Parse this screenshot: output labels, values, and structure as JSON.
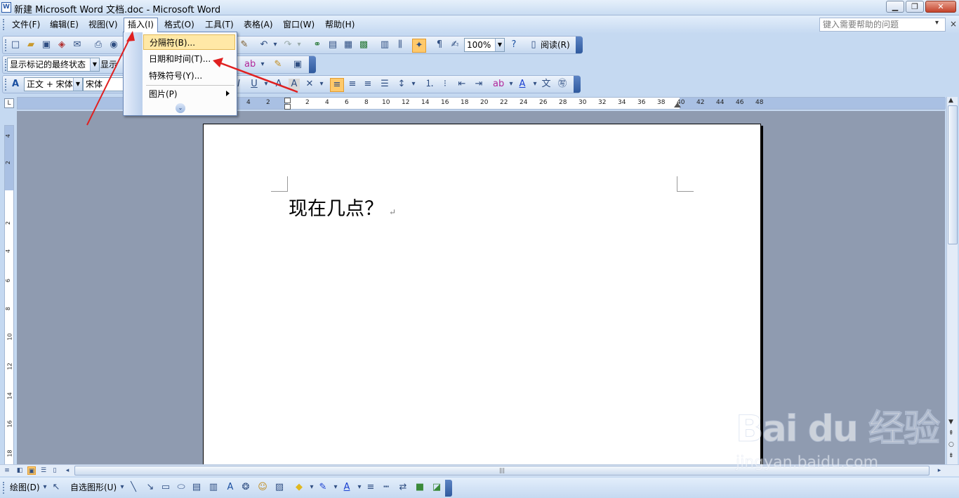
{
  "window": {
    "title": "新建 Microsoft Word 文档.doc - Microsoft Word",
    "min": "▁",
    "max": "❐",
    "close": "✕"
  },
  "menubar": {
    "items": [
      "文件(F)",
      "编辑(E)",
      "视图(V)",
      "插入(I)",
      "格式(O)",
      "工具(T)",
      "表格(A)",
      "窗口(W)",
      "帮助(H)"
    ]
  },
  "help": {
    "placeholder": "键入需要帮助的问题",
    "drop": "▾",
    "close": "×"
  },
  "standard_toolbar": {
    "zoom": "100%",
    "read_label": "阅读(R)"
  },
  "reviewing_toolbar": {
    "markup_state": "显示标记的最终状态",
    "show_label": "显示"
  },
  "formatting_toolbar": {
    "style": "正文 + 宋体",
    "font": "宋体"
  },
  "insert_menu": {
    "items": [
      "分隔符(B)...",
      "日期和时间(T)...",
      "特殊符号(Y)...",
      "图片(P)"
    ]
  },
  "ruler": {
    "h_labels": [
      "4",
      "2",
      "2",
      "4",
      "6",
      "8",
      "10",
      "12",
      "14",
      "16",
      "18",
      "20",
      "22",
      "24",
      "26",
      "28",
      "30",
      "32",
      "34",
      "36",
      "38",
      "40",
      "42",
      "44",
      "46",
      "48"
    ],
    "v_labels": [
      "4",
      "2",
      "2",
      "4",
      "6",
      "8",
      "10",
      "12",
      "14",
      "16",
      "18"
    ],
    "corner": "L"
  },
  "document": {
    "text": "现在几点？",
    "para_mark": "↵"
  },
  "drawing_toolbar": {
    "draw_label": "绘图(D)",
    "autoshapes_label": "自选图形(U)"
  },
  "watermark": {
    "logo": "Bai du 经验",
    "url": "jingyan.baidu.com"
  },
  "colors": {
    "menu_highlight": "#ffe8a6",
    "toolbar_blue": "#c4d7ef",
    "doc_background": "#8f9bb0",
    "arrow_red": "#e02020"
  }
}
